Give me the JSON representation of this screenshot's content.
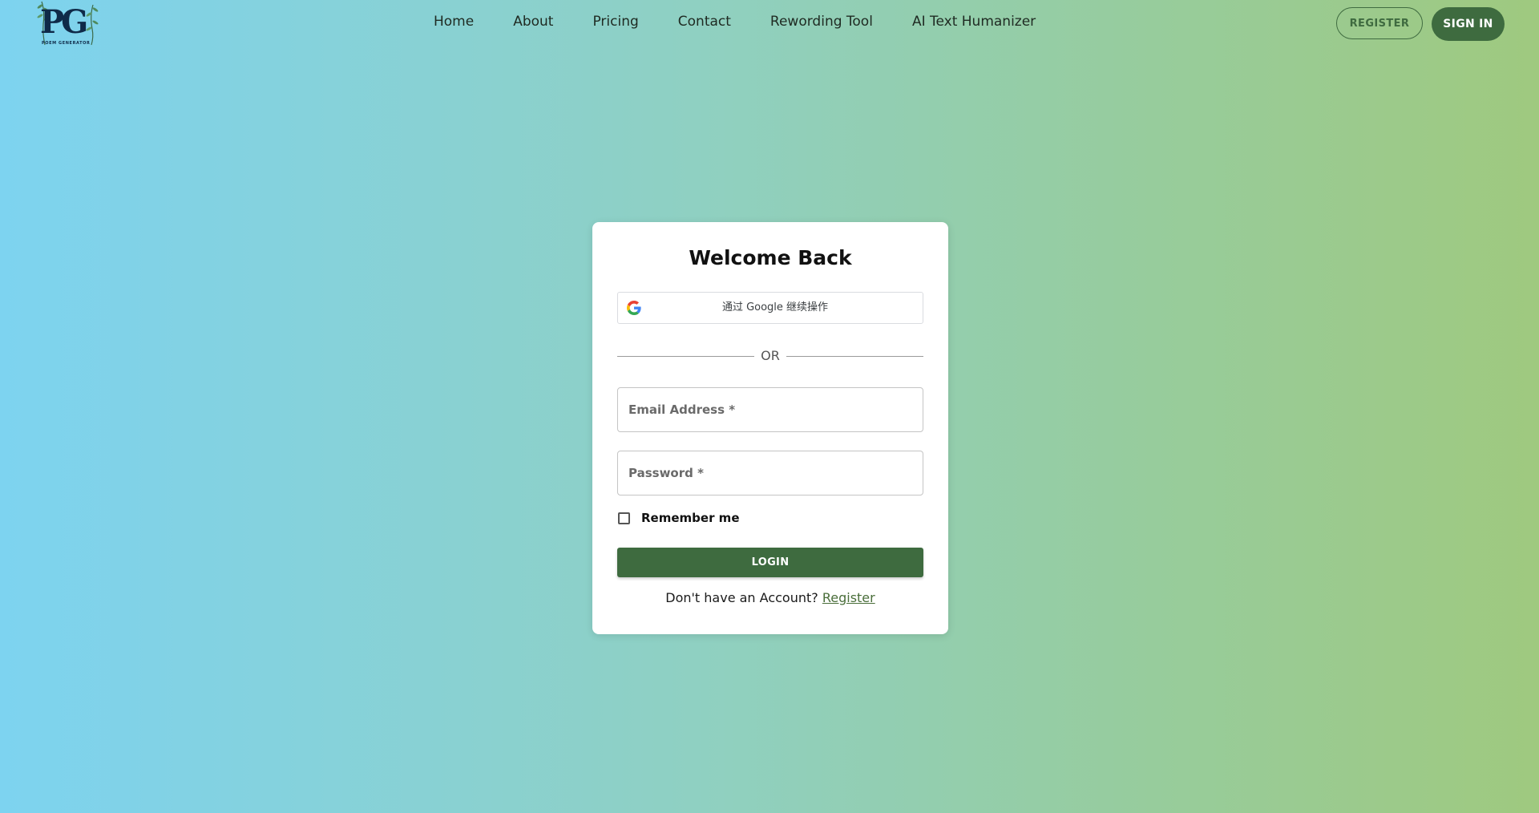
{
  "brand": {
    "logo_letters": "PG",
    "logo_subtitle": "POEM GENERATOR"
  },
  "nav": {
    "items": [
      {
        "label": "Home"
      },
      {
        "label": "About"
      },
      {
        "label": "Pricing"
      },
      {
        "label": "Contact"
      },
      {
        "label": "Rewording Tool"
      },
      {
        "label": "AI Text Humanizer"
      }
    ]
  },
  "header_actions": {
    "register_label": "REGISTER",
    "signin_label": "SIGN IN"
  },
  "login_card": {
    "title": "Welcome Back",
    "google_label": "通过 Google 继续操作",
    "divider_text": "OR",
    "email_label": "Email Address *",
    "email_value": "",
    "password_label": "Password *",
    "password_value": "",
    "remember_label": "Remember me",
    "remember_checked": false,
    "login_label": "LOGIN",
    "no_account_text": "Don't have an Account?",
    "register_link": "Register"
  },
  "icons": {
    "google": "google-g-icon"
  },
  "colors": {
    "accent_green": "#3e6b3f",
    "link_green": "#4a6e3a",
    "gradient_start": "#7dd3f0",
    "gradient_end": "#9fc97f",
    "logo_navy": "#0f2a48"
  }
}
